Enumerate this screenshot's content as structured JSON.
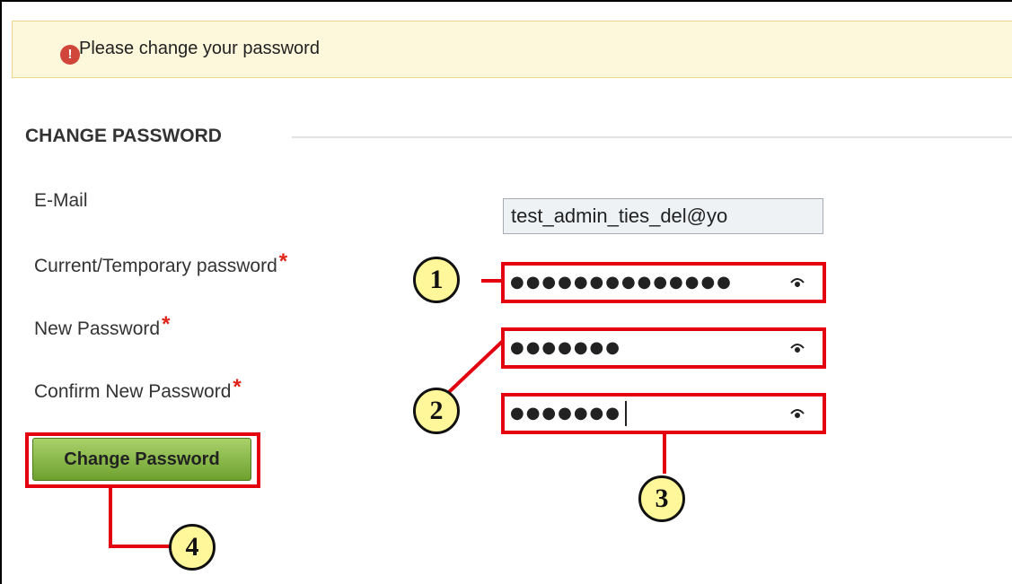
{
  "alert": {
    "icon": "error-exclamation-icon",
    "message": "Please change your password"
  },
  "section": {
    "title": "CHANGE PASSWORD"
  },
  "form": {
    "email": {
      "label": "E-Mail",
      "value": "test_admin_ties_del@yo"
    },
    "current_password": {
      "label": "Current/Temporary password",
      "required_mark": "*",
      "masked_value": "●●●●●●●●●●●●●●",
      "icon": "show-password-eye-icon"
    },
    "new_password": {
      "label": "New Password",
      "required_mark": "*",
      "masked_value": "●●●●●●●",
      "icon": "show-password-eye-icon"
    },
    "confirm_password": {
      "label": "Confirm New Password",
      "required_mark": "*",
      "masked_value": "●●●●●●●",
      "icon": "show-password-eye-icon"
    },
    "submit_label": "Change Password"
  },
  "callouts": [
    "1",
    "2",
    "3",
    "4"
  ],
  "colors": {
    "highlight": "#e3000f",
    "callout_fill": "#fff799",
    "button_green": "#6ea12f",
    "alert_bg": "#fdf8db",
    "required": "#e2231a"
  }
}
